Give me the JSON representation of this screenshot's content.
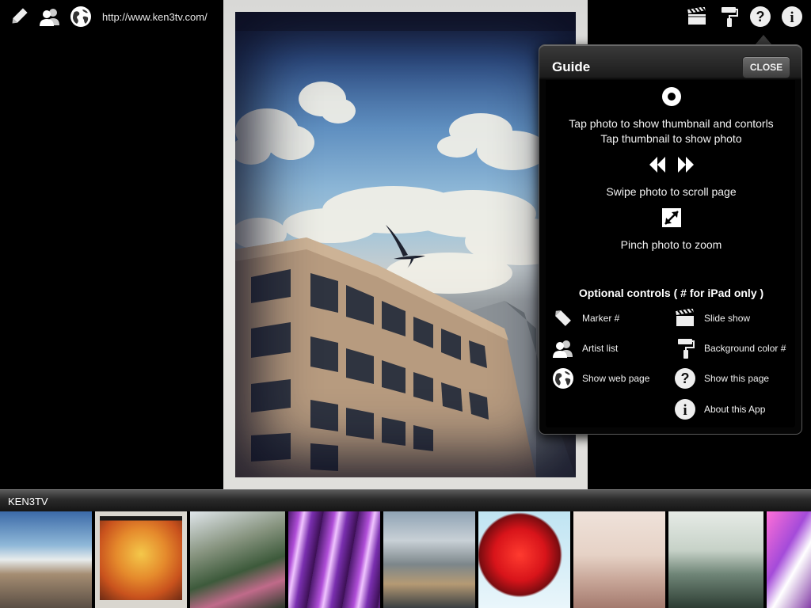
{
  "toolbar": {
    "url": "http://www.ken3tv.com/"
  },
  "guide": {
    "title": "Guide",
    "close_label": "CLOSE",
    "tap_line1": "Tap photo to show thumbnail and contorls",
    "tap_line2": "Tap thumbnail to show photo",
    "swipe": "Swipe photo to scroll page",
    "pinch": "Pinch photo to zoom",
    "optional_header": "Optional controls ( # for iPad only )",
    "controls": [
      {
        "label": "Marker #",
        "icon": "marker-icon"
      },
      {
        "label": "Slide show",
        "icon": "clapperboard-icon"
      },
      {
        "label": "Artist list",
        "icon": "artists-icon"
      },
      {
        "label": "Background color #",
        "icon": "paint-roller-icon"
      },
      {
        "label": "Show web page",
        "icon": "globe-icon"
      },
      {
        "label": "Show this page",
        "icon": "help-icon"
      },
      {
        "label": "About this App",
        "icon": "info-icon"
      }
    ]
  },
  "strip": {
    "title": "KEN3TV"
  },
  "colors": {
    "background": "#000000",
    "popover_header": "#3a3a3a",
    "strip_bar": "#2a2a2a"
  }
}
